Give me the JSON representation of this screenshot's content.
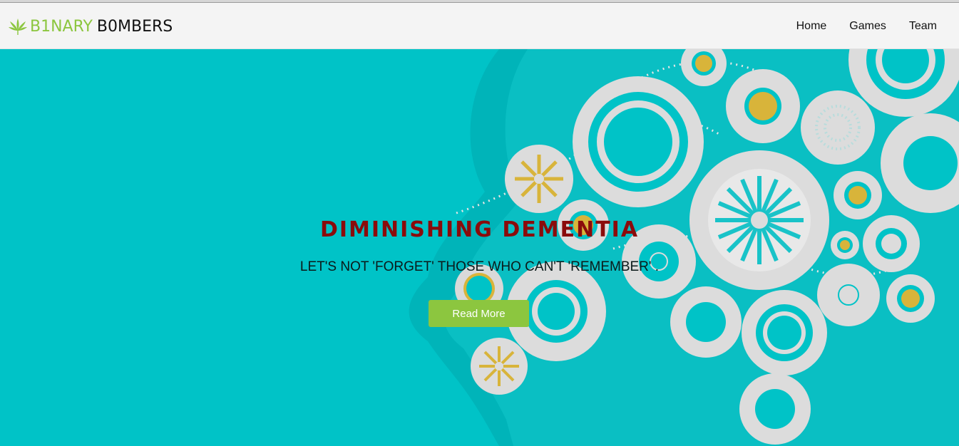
{
  "brand": {
    "part1": "B1NARY",
    "part2": "B0MBERS",
    "logo_icon": "cannabis-leaf-icon",
    "accent_color": "#8cc63f"
  },
  "nav": {
    "items": [
      {
        "label": "Home"
      },
      {
        "label": "Games"
      },
      {
        "label": "Team"
      }
    ]
  },
  "hero": {
    "title": "DIMINISHING DEMENTIA",
    "subtitle": "LET'S NOT 'FORGET' THOSE WHO CAN'T 'REMEMBER' .",
    "button_label": "Read More",
    "background_color": "#00c3c7",
    "title_color": "#8b0b0b",
    "illustration": "head-silhouette-with-gears"
  }
}
